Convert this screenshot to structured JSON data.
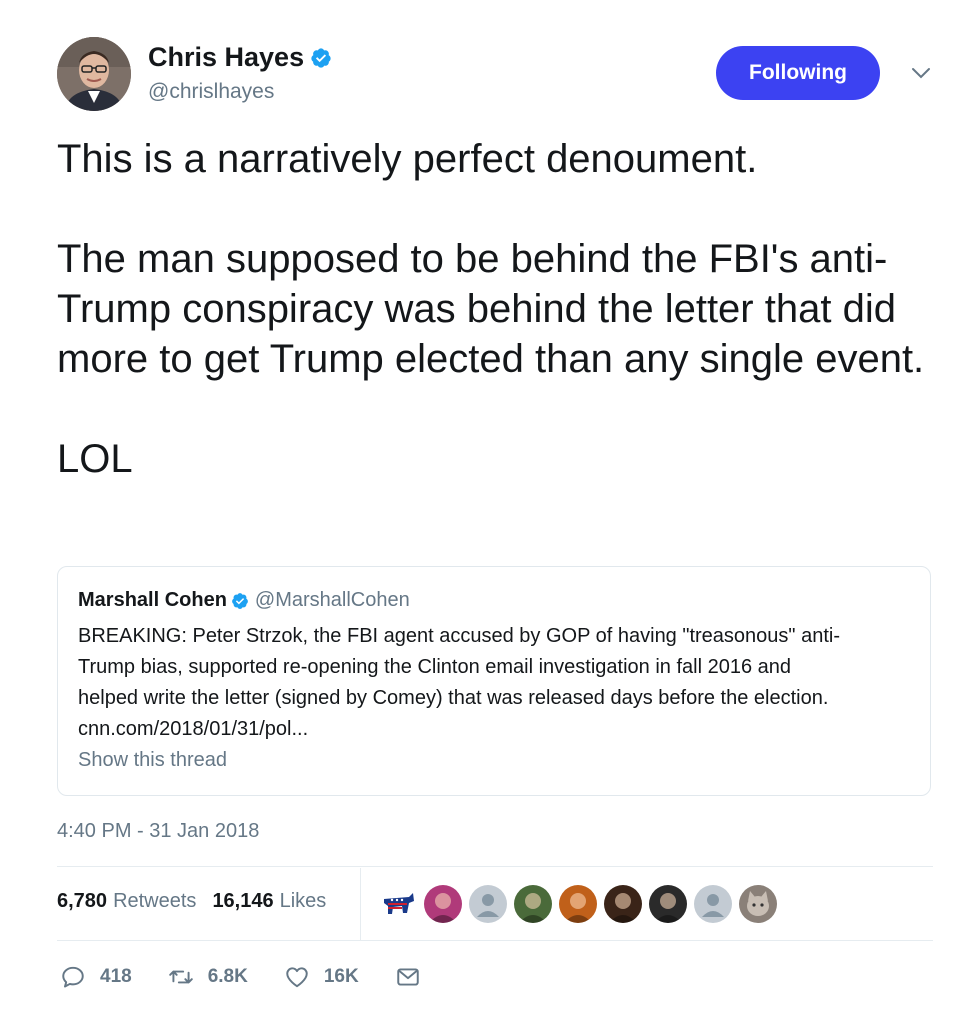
{
  "author": {
    "name": "Chris Hayes",
    "handle": "@chrislhayes",
    "verified": true
  },
  "follow_button": {
    "label": "Following",
    "color": "#3c42f2"
  },
  "tweet": {
    "paragraphs": [
      "This is a narratively perfect denoument.",
      "The man supposed to be behind the FBI's anti-Trump conspiracy was behind the letter that did more to get Trump elected than any single event.",
      "LOL"
    ]
  },
  "quoted_tweet": {
    "name": "Marshall Cohen",
    "handle": "@MarshallCohen",
    "verified": true,
    "text": "BREAKING: Peter Strzok, the FBI agent accused by GOP of having \"treasonous\" anti-\nTrump bias, supported re-opening the Clinton email investigation in fall 2016 and\nhelped write the letter (signed by Comey) that was released days before the election.\ncnn.com/2018/01/31/pol...",
    "show_thread": "Show this thread"
  },
  "timestamp": "4:40 PM - 31 Jan 2018",
  "stats": {
    "retweets_count": "6,780",
    "retweets_label": "Retweets",
    "likes_count": "16,146",
    "likes_label": "Likes"
  },
  "liker_avatars": [
    {
      "icon": "democrat-donkey-avatar",
      "color": "#1a3a8a"
    },
    {
      "icon": "user-avatar",
      "color": "#b03a7a"
    },
    {
      "icon": "default-user-avatar",
      "color": "#c3cbd3"
    },
    {
      "icon": "user-avatar",
      "color": "#4a6a3a"
    },
    {
      "icon": "user-avatar",
      "color": "#c0601a"
    },
    {
      "icon": "user-avatar",
      "color": "#3a2418"
    },
    {
      "icon": "user-avatar",
      "color": "#2a2a2a"
    },
    {
      "icon": "default-user-avatar",
      "color": "#c3cbd3"
    },
    {
      "icon": "cat-avatar",
      "color": "#8a8078"
    }
  ],
  "actions": {
    "reply_count": "418",
    "retweet_count": "6.8K",
    "like_count": "16K"
  },
  "colors": {
    "verified_blue": "#1da1f2",
    "secondary_text": "#657786",
    "border": "#e1e8ed"
  }
}
